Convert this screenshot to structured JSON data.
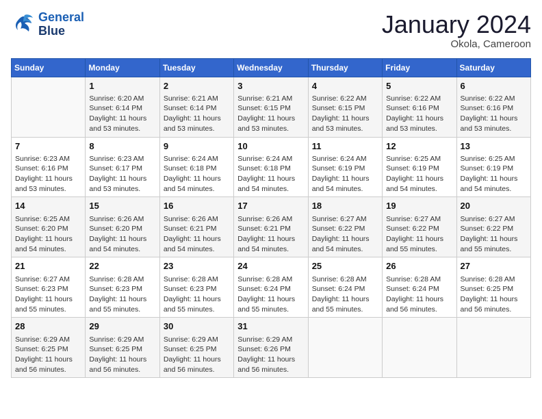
{
  "header": {
    "logo_line1": "General",
    "logo_line2": "Blue",
    "month_year": "January 2024",
    "location": "Okola, Cameroon"
  },
  "weekdays": [
    "Sunday",
    "Monday",
    "Tuesday",
    "Wednesday",
    "Thursday",
    "Friday",
    "Saturday"
  ],
  "weeks": [
    [
      {
        "day": "",
        "info": ""
      },
      {
        "day": "1",
        "info": "Sunrise: 6:20 AM\nSunset: 6:14 PM\nDaylight: 11 hours\nand 53 minutes."
      },
      {
        "day": "2",
        "info": "Sunrise: 6:21 AM\nSunset: 6:14 PM\nDaylight: 11 hours\nand 53 minutes."
      },
      {
        "day": "3",
        "info": "Sunrise: 6:21 AM\nSunset: 6:15 PM\nDaylight: 11 hours\nand 53 minutes."
      },
      {
        "day": "4",
        "info": "Sunrise: 6:22 AM\nSunset: 6:15 PM\nDaylight: 11 hours\nand 53 minutes."
      },
      {
        "day": "5",
        "info": "Sunrise: 6:22 AM\nSunset: 6:16 PM\nDaylight: 11 hours\nand 53 minutes."
      },
      {
        "day": "6",
        "info": "Sunrise: 6:22 AM\nSunset: 6:16 PM\nDaylight: 11 hours\nand 53 minutes."
      }
    ],
    [
      {
        "day": "7",
        "info": "Sunrise: 6:23 AM\nSunset: 6:16 PM\nDaylight: 11 hours\nand 53 minutes."
      },
      {
        "day": "8",
        "info": "Sunrise: 6:23 AM\nSunset: 6:17 PM\nDaylight: 11 hours\nand 53 minutes."
      },
      {
        "day": "9",
        "info": "Sunrise: 6:24 AM\nSunset: 6:18 PM\nDaylight: 11 hours\nand 54 minutes."
      },
      {
        "day": "10",
        "info": "Sunrise: 6:24 AM\nSunset: 6:18 PM\nDaylight: 11 hours\nand 54 minutes."
      },
      {
        "day": "11",
        "info": "Sunrise: 6:24 AM\nSunset: 6:19 PM\nDaylight: 11 hours\nand 54 minutes."
      },
      {
        "day": "12",
        "info": "Sunrise: 6:25 AM\nSunset: 6:19 PM\nDaylight: 11 hours\nand 54 minutes."
      },
      {
        "day": "13",
        "info": "Sunrise: 6:25 AM\nSunset: 6:19 PM\nDaylight: 11 hours\nand 54 minutes."
      }
    ],
    [
      {
        "day": "14",
        "info": "Sunrise: 6:25 AM\nSunset: 6:20 PM\nDaylight: 11 hours\nand 54 minutes."
      },
      {
        "day": "15",
        "info": "Sunrise: 6:26 AM\nSunset: 6:20 PM\nDaylight: 11 hours\nand 54 minutes."
      },
      {
        "day": "16",
        "info": "Sunrise: 6:26 AM\nSunset: 6:21 PM\nDaylight: 11 hours\nand 54 minutes."
      },
      {
        "day": "17",
        "info": "Sunrise: 6:26 AM\nSunset: 6:21 PM\nDaylight: 11 hours\nand 54 minutes."
      },
      {
        "day": "18",
        "info": "Sunrise: 6:27 AM\nSunset: 6:22 PM\nDaylight: 11 hours\nand 54 minutes."
      },
      {
        "day": "19",
        "info": "Sunrise: 6:27 AM\nSunset: 6:22 PM\nDaylight: 11 hours\nand 55 minutes."
      },
      {
        "day": "20",
        "info": "Sunrise: 6:27 AM\nSunset: 6:22 PM\nDaylight: 11 hours\nand 55 minutes."
      }
    ],
    [
      {
        "day": "21",
        "info": "Sunrise: 6:27 AM\nSunset: 6:23 PM\nDaylight: 11 hours\nand 55 minutes."
      },
      {
        "day": "22",
        "info": "Sunrise: 6:28 AM\nSunset: 6:23 PM\nDaylight: 11 hours\nand 55 minutes."
      },
      {
        "day": "23",
        "info": "Sunrise: 6:28 AM\nSunset: 6:23 PM\nDaylight: 11 hours\nand 55 minutes."
      },
      {
        "day": "24",
        "info": "Sunrise: 6:28 AM\nSunset: 6:24 PM\nDaylight: 11 hours\nand 55 minutes."
      },
      {
        "day": "25",
        "info": "Sunrise: 6:28 AM\nSunset: 6:24 PM\nDaylight: 11 hours\nand 55 minutes."
      },
      {
        "day": "26",
        "info": "Sunrise: 6:28 AM\nSunset: 6:24 PM\nDaylight: 11 hours\nand 56 minutes."
      },
      {
        "day": "27",
        "info": "Sunrise: 6:28 AM\nSunset: 6:25 PM\nDaylight: 11 hours\nand 56 minutes."
      }
    ],
    [
      {
        "day": "28",
        "info": "Sunrise: 6:29 AM\nSunset: 6:25 PM\nDaylight: 11 hours\nand 56 minutes."
      },
      {
        "day": "29",
        "info": "Sunrise: 6:29 AM\nSunset: 6:25 PM\nDaylight: 11 hours\nand 56 minutes."
      },
      {
        "day": "30",
        "info": "Sunrise: 6:29 AM\nSunset: 6:25 PM\nDaylight: 11 hours\nand 56 minutes."
      },
      {
        "day": "31",
        "info": "Sunrise: 6:29 AM\nSunset: 6:26 PM\nDaylight: 11 hours\nand 56 minutes."
      },
      {
        "day": "",
        "info": ""
      },
      {
        "day": "",
        "info": ""
      },
      {
        "day": "",
        "info": ""
      }
    ]
  ]
}
